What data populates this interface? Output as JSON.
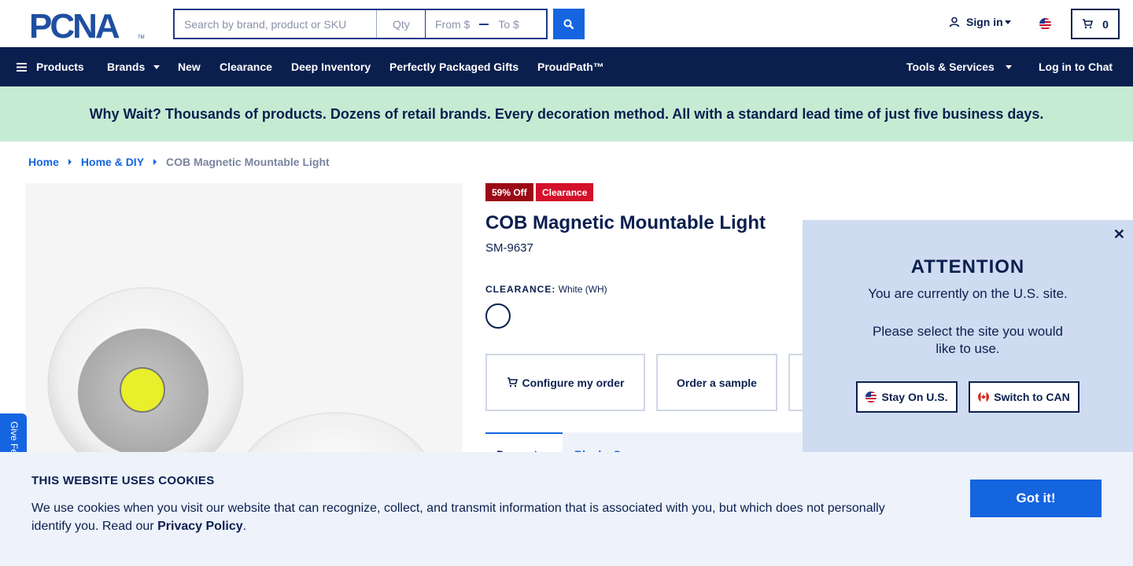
{
  "header": {
    "logo_text": "PCNA",
    "search": {
      "placeholder": "Search by brand, product or SKU",
      "qty_placeholder": "Qty",
      "price_from_placeholder": "From $",
      "price_to_placeholder": "To $"
    },
    "signin_label": "Sign in",
    "cart_count": "0"
  },
  "nav": {
    "products": "Products",
    "brands": "Brands",
    "new": "New",
    "clearance": "Clearance",
    "deep_inventory": "Deep Inventory",
    "perfectly_packaged_gifts": "Perfectly Packaged Gifts",
    "proudpath": "ProudPath™",
    "tools_services": "Tools & Services",
    "log_in_chat": "Log in to Chat"
  },
  "promo_banner": "Why Wait? Thousands of products. Dozens of retail brands. Every decoration method. All with a standard lead time of just five business days.",
  "breadcrumb": {
    "home": "Home",
    "category": "Home & DIY",
    "current": "COB Magnetic Mountable Light"
  },
  "product": {
    "badge_discount": "59% Off",
    "badge_clearance": "Clearance",
    "title": "COB Magnetic Mountable Light",
    "sku": "SM-9637",
    "clearance_label": "CLEARANCE:",
    "color_value": "White (WH)",
    "configure_label": "Configure my order",
    "sample_label": "Order a sample",
    "tab_1_partial": "Decorat",
    "tab_2_partial": "Blank   Supp"
  },
  "feedback_label": "Give Fe",
  "modal": {
    "title": "ATTENTION",
    "line1": "You are currently on the U.S. site.",
    "line2": "Please select the site you would like to use.",
    "stay_label": "Stay On U.S.",
    "switch_label": "Switch to CAN"
  },
  "cookie": {
    "title": "THIS WEBSITE USES COOKIES",
    "text": "We use cookies when you visit our website that can recognize, collect, and transmit information that is associated with you, but which does not personally identify you. Read our",
    "link": "Privacy Policy",
    "period": ".",
    "button": "Got it!"
  },
  "colors": {
    "navy": "#0b1f4f",
    "brand_blue": "#1565e0",
    "promo_green": "#c6ebd3",
    "clearance_red": "#d4102a",
    "discount_red": "#9b0a16",
    "modal_bg": "#cfdbf0",
    "cookie_bg": "#edf2fb"
  }
}
